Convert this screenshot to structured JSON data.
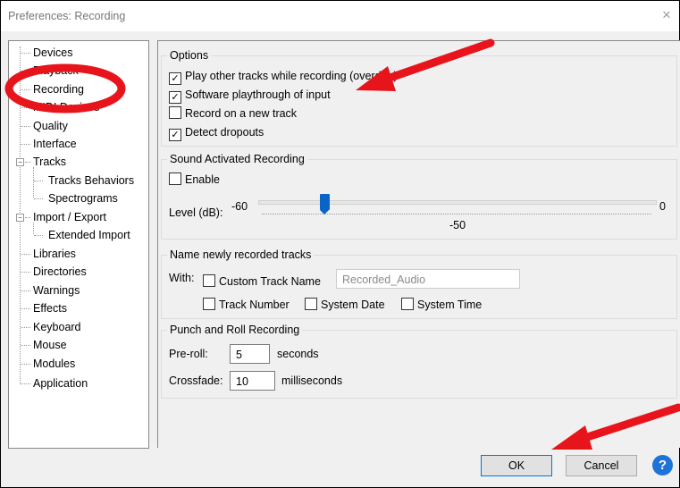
{
  "window": {
    "title": "Preferences: Recording",
    "close_glyph": "×"
  },
  "tree": {
    "items": [
      {
        "label": "Devices"
      },
      {
        "label": "Playback"
      },
      {
        "label": "Recording"
      },
      {
        "label": "MIDI Devices"
      },
      {
        "label": "Quality"
      },
      {
        "label": "Interface"
      },
      {
        "label": "Tracks",
        "expander": "−"
      },
      {
        "label": "Tracks Behaviors"
      },
      {
        "label": "Spectrograms"
      },
      {
        "label": "Import / Export",
        "expander": "−"
      },
      {
        "label": "Extended Import"
      },
      {
        "label": "Libraries"
      },
      {
        "label": "Directories"
      },
      {
        "label": "Warnings"
      },
      {
        "label": "Effects"
      },
      {
        "label": "Keyboard"
      },
      {
        "label": "Mouse"
      },
      {
        "label": "Modules"
      },
      {
        "label": "Application"
      }
    ]
  },
  "options": {
    "title": "Options",
    "items": [
      {
        "label": "Play other tracks while recording (overdub)",
        "checked": true
      },
      {
        "label": "Software playthrough of input",
        "checked": true
      },
      {
        "label": "Record on a new track",
        "checked": false
      },
      {
        "label": "Detect dropouts",
        "checked": true
      }
    ]
  },
  "sound_activated": {
    "title": "Sound Activated Recording",
    "enable_label": "Enable",
    "enable_checked": false,
    "level_label": "Level (dB):",
    "min_label": "-60",
    "max_label": "0",
    "value_label": "-50",
    "min": -60,
    "max": 0,
    "value": -50
  },
  "naming": {
    "title": "Name newly recorded tracks",
    "with_label": "With:",
    "custom_label": "Custom Track Name",
    "custom_value": "Recorded_Audio",
    "track_number_label": "Track Number",
    "system_date_label": "System Date",
    "system_time_label": "System Time"
  },
  "punch": {
    "title": "Punch and Roll Recording",
    "preroll_label": "Pre-roll:",
    "preroll_value": "5",
    "preroll_unit": "seconds",
    "crossfade_label": "Crossfade:",
    "crossfade_value": "10",
    "crossfade_unit": "milliseconds"
  },
  "buttons": {
    "ok": "OK",
    "cancel": "Cancel",
    "help": "?"
  },
  "colors": {
    "accent": "#0a64c8",
    "annotation": "#e8141c",
    "help": "#1e73d8"
  },
  "glyphs": {
    "check": "✓"
  }
}
